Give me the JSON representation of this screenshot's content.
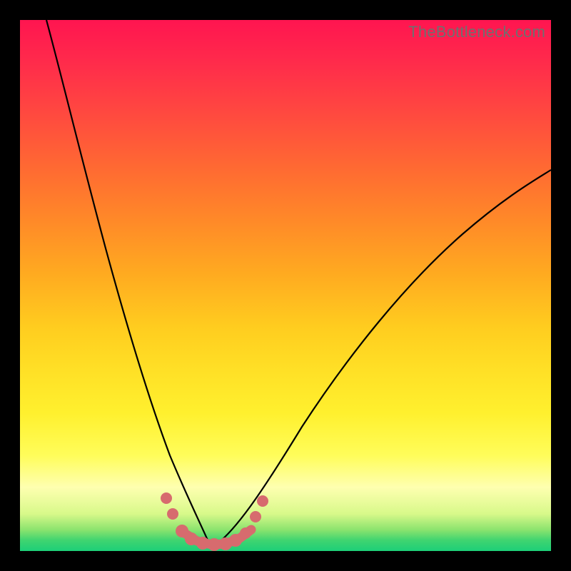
{
  "watermark": {
    "text": "TheBottleneck.com"
  },
  "chart_data": {
    "type": "line",
    "title": "",
    "xlabel": "",
    "ylabel": "",
    "xlim": [
      0,
      100
    ],
    "ylim": [
      0,
      100
    ],
    "background": {
      "gradient_axis": "y",
      "stops": [
        {
          "pos": 100,
          "color": "#ff1550",
          "meaning": "severe-bottleneck"
        },
        {
          "pos": 50,
          "color": "#ffcd1f",
          "meaning": "moderate"
        },
        {
          "pos": 10,
          "color": "#fffd5a",
          "meaning": "mild"
        },
        {
          "pos": 0,
          "color": "#1dcf78",
          "meaning": "no-bottleneck"
        }
      ]
    },
    "series": [
      {
        "name": "left-curve",
        "x": [
          5,
          8,
          12,
          16,
          20,
          24,
          27,
          30,
          33,
          36
        ],
        "y": [
          100,
          88,
          72,
          56,
          41,
          27,
          17,
          9,
          3,
          0
        ]
      },
      {
        "name": "right-curve",
        "x": [
          36,
          40,
          46,
          54,
          62,
          72,
          82,
          92,
          100
        ],
        "y": [
          0,
          2,
          8,
          18,
          30,
          43,
          55,
          65,
          72
        ]
      }
    ],
    "markers": {
      "name": "bottleneck-zone",
      "color": "#d76b6e",
      "points": [
        {
          "x": 27.5,
          "y": 10
        },
        {
          "x": 28.8,
          "y": 7
        },
        {
          "x": 30.5,
          "y": 3.2
        },
        {
          "x": 32.0,
          "y": 1.6
        },
        {
          "x": 34.0,
          "y": 1.0
        },
        {
          "x": 36.0,
          "y": 0.9
        },
        {
          "x": 38.0,
          "y": 1.0
        },
        {
          "x": 40.0,
          "y": 1.6
        },
        {
          "x": 42.5,
          "y": 4.2
        },
        {
          "x": 44.5,
          "y": 7.0
        },
        {
          "x": 46.0,
          "y": 9.5
        }
      ]
    }
  }
}
